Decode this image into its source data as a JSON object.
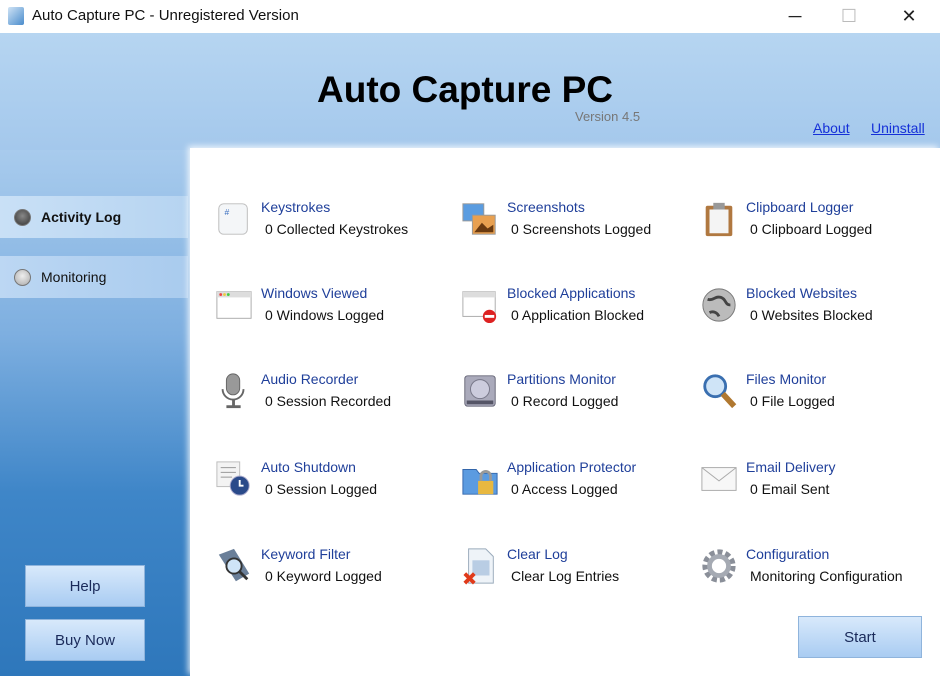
{
  "window": {
    "title": "Auto Capture PC - Unregistered Version",
    "minimize": "─",
    "maximize": "☐",
    "close": "✕"
  },
  "header": {
    "app_name": "Auto Capture PC",
    "version": "Version 4.5",
    "about": "About",
    "uninstall": "Uninstall"
  },
  "sidebar": {
    "items": [
      {
        "label": "Activity Log",
        "selected": true
      },
      {
        "label": "Monitoring",
        "selected": false
      }
    ],
    "help": "Help",
    "buy_now": "Buy Now"
  },
  "items": [
    {
      "title": "Keystrokes",
      "sub": "0 Collected Keystrokes",
      "icon": "keyboard-key-icon"
    },
    {
      "title": "Screenshots",
      "sub": "0 Screenshots Logged",
      "icon": "screenshot-icon"
    },
    {
      "title": "Clipboard Logger",
      "sub": "0 Clipboard Logged",
      "icon": "clipboard-icon"
    },
    {
      "title": "Windows Viewed",
      "sub": "0 Windows Logged",
      "icon": "window-icon"
    },
    {
      "title": "Blocked Applications",
      "sub": "0 Application Blocked",
      "icon": "blocked-window-icon"
    },
    {
      "title": "Blocked Websites",
      "sub": "0 Websites Blocked",
      "icon": "globe-icon"
    },
    {
      "title": "Audio Recorder",
      "sub": "0 Session Recorded",
      "icon": "microphone-icon"
    },
    {
      "title": "Partitions Monitor",
      "sub": "0 Record Logged",
      "icon": "hard-drive-icon"
    },
    {
      "title": "Files Monitor",
      "sub": "0 File Logged",
      "icon": "magnifier-icon"
    },
    {
      "title": "Auto Shutdown",
      "sub": "0 Session Logged",
      "icon": "clock-list-icon"
    },
    {
      "title": "Application Protector",
      "sub": "0 Access Logged",
      "icon": "folder-lock-icon"
    },
    {
      "title": "Email Delivery",
      "sub": "0 Email Sent",
      "icon": "envelope-icon"
    },
    {
      "title": "Keyword Filter",
      "sub": "0 Keyword Logged",
      "icon": "keyword-search-icon"
    },
    {
      "title": "Clear Log",
      "sub": "Clear Log Entries",
      "icon": "clear-document-icon"
    },
    {
      "title": "Configuration",
      "sub": "Monitoring Configuration",
      "icon": "gear-icon"
    }
  ],
  "start": "Start",
  "colors": {
    "link": "#1530d8",
    "item_title": "#1f3f9a",
    "sidebar_dark": "#2e77bb",
    "header": "#b6d5f1"
  }
}
